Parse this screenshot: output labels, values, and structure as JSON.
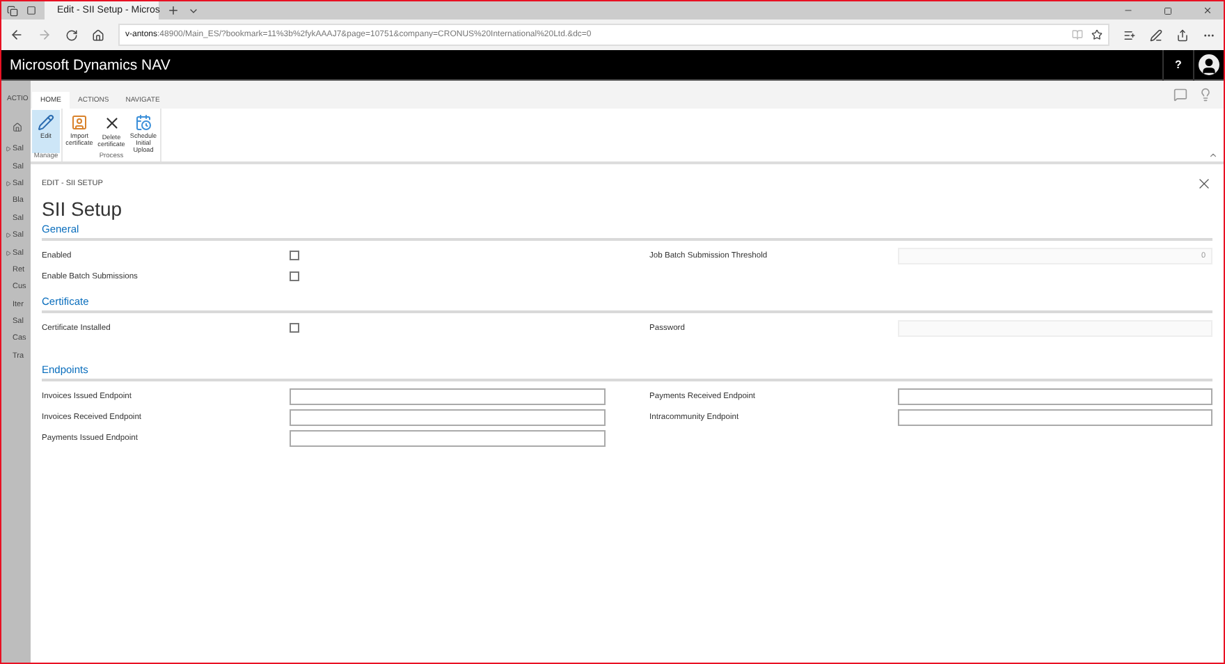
{
  "browser": {
    "tab_title": "Edit - SII Setup - Micros",
    "url_host": "v-antons",
    "url_rest": ":48900/Main_ES/?bookmark=11%3b%2fykAAAJ7&page=10751&company=CRONUS%20International%20Ltd.&dc=0"
  },
  "app_bar": {
    "title": "Microsoft Dynamics NAV",
    "help": "?"
  },
  "background": {
    "tab": "ACTIO",
    "items": [
      {
        "label": "Sal",
        "expandable": true
      },
      {
        "label": "Sal",
        "expandable": false
      },
      {
        "label": "Sal",
        "expandable": true
      },
      {
        "label": "Bla",
        "expandable": false
      },
      {
        "label": "Sal",
        "expandable": false
      },
      {
        "label": "Sal",
        "expandable": true
      },
      {
        "label": "Sal",
        "expandable": true
      },
      {
        "label": "Ret",
        "expandable": false
      },
      {
        "label": "Cus",
        "expandable": false
      },
      {
        "label": "Iter",
        "expandable": false
      },
      {
        "label": "Sal",
        "expandable": false
      },
      {
        "label": "Cas",
        "expandable": false
      },
      {
        "label": "Tra",
        "expandable": false
      }
    ]
  },
  "ribbon": {
    "tabs": [
      {
        "label": "HOME",
        "selected": true
      },
      {
        "label": "ACTIONS",
        "selected": false
      },
      {
        "label": "NAVIGATE",
        "selected": false
      }
    ],
    "groups": [
      {
        "label": "Manage",
        "actions": [
          {
            "label": "Edit",
            "kind": "edit",
            "selected": true
          }
        ]
      },
      {
        "label": "Process",
        "actions": [
          {
            "label": "Import certificate",
            "kind": "import",
            "selected": false
          },
          {
            "label": "Delete certificate",
            "kind": "delete",
            "selected": false
          },
          {
            "label": "Schedule Initial Upload",
            "kind": "schedule",
            "selected": false
          }
        ]
      }
    ]
  },
  "dialog": {
    "breadcrumb": "EDIT - SII SETUP",
    "title": "SII Setup",
    "sections": [
      {
        "title": "General",
        "left": [
          {
            "label": "Enabled",
            "kind": "checkbox",
            "checked": false
          },
          {
            "label": "Enable Batch Submissions",
            "kind": "checkbox",
            "checked": false
          }
        ],
        "right": [
          {
            "label": "Job Batch Submission Threshold",
            "kind": "text",
            "value": "0",
            "disabled": true
          }
        ]
      },
      {
        "title": "Certificate",
        "left": [
          {
            "label": "Certificate Installed",
            "kind": "checkbox",
            "checked": false
          }
        ],
        "right": [
          {
            "label": "Password",
            "kind": "text",
            "disabled": true
          }
        ]
      },
      {
        "title": "Endpoints",
        "left": [
          {
            "label": "Invoices Issued Endpoint",
            "kind": "text",
            "disabled": false
          },
          {
            "label": "Invoices Received Endpoint",
            "kind": "text",
            "disabled": false
          },
          {
            "label": "Payments Issued Endpoint",
            "kind": "text",
            "disabled": false
          }
        ],
        "right": [
          {
            "label": "Payments Received Endpoint",
            "kind": "text",
            "disabled": false
          },
          {
            "label": "Intracommunity Endpoint",
            "kind": "text",
            "disabled": false
          }
        ]
      }
    ]
  }
}
